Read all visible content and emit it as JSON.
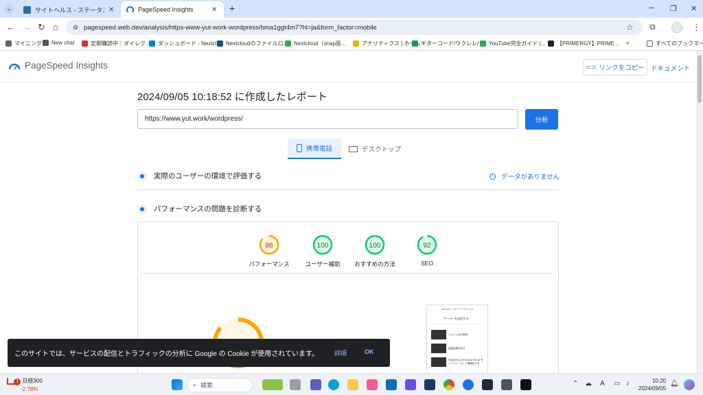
{
  "browser": {
    "tabs": [
      {
        "title": "サイトヘルス - ステータス ‹ サーバーで",
        "active": false
      },
      {
        "title": "PageSpeed Insights",
        "active": true
      }
    ],
    "new_tab": "+",
    "address": "pagespeed.web.dev/analysis/https-www-yut-work-wordpress/bma1ggt4m7?hl=ja&form_factor=mobile",
    "bookmarks": [
      {
        "label": "マイニング",
        "icon": "folder-icon",
        "color": "#5f6368"
      },
      {
        "label": "New chat",
        "icon": "openai-icon",
        "color": "#555555"
      },
      {
        "label": "定期購読中｜ダイレク...",
        "icon": "red-dot-icon",
        "color": "#d93025"
      },
      {
        "label": "ダッシュボード - Nextcl...",
        "icon": "nextcloud-icon",
        "color": "#0082c9"
      },
      {
        "label": "Nextcloudのファイルロ...",
        "icon": "n-icon",
        "color": "#0b5394"
      },
      {
        "label": "Nextcloud（snap版...",
        "icon": "green-icon",
        "color": "#34a853"
      },
      {
        "label": "アナリティクス | ホーム",
        "icon": "analytics-icon",
        "color": "#f9ab00"
      },
      {
        "label": "ギターコード/ウクレレ/ピ...",
        "icon": "chord-icon",
        "color": "#0f9d58"
      },
      {
        "label": "YouTube完全ガイド |...",
        "icon": "green-icon",
        "color": "#34a853"
      },
      {
        "label": "【PRIMERGY】PRIME...",
        "icon": "globe-icon",
        "color": "#202124"
      }
    ],
    "bookmarks_more": "»",
    "all_bookmarks": "すべてのブックマーク"
  },
  "page": {
    "brand": "PageSpeed Insights",
    "copy_link": "リンクをコピー",
    "docs": "ドキュメント",
    "report_title": "2024/09/05 10:18:52 に作成したレポート",
    "url_value": "https://www.yut.work/wordpress/",
    "analyze_button": "分析",
    "device_tabs": [
      {
        "label": "携帯電話",
        "active": true
      },
      {
        "label": "デスクトップ",
        "active": false
      }
    ],
    "field_section": "実際のユーザーの環境で評価する",
    "no_data": "データがありません",
    "lab_section": "パフォーマンスの問題を診断する",
    "scores": [
      {
        "label": "パフォーマンス",
        "value": "86",
        "color": "#ffa400"
      },
      {
        "label": "ユーザー補助",
        "value": "100",
        "color": "#0cce6b"
      },
      {
        "label": "おすすめの方法",
        "value": "100",
        "color": "#0cce6b"
      },
      {
        "label": "SEO",
        "value": "92",
        "color": "#0cce6b"
      }
    ],
    "thumb_lines": [
      "yut.work 〜 サーバーのヘルス",
      "サーバーを自作する！",
      "ドメイン名の取得",
      "容量拡張の仕方",
      "Raspberry pi 5 Ubuntu Server をインストールして最適化する"
    ]
  },
  "cookie": {
    "message": "このサイトでは、サービスの配信とトラフィックの分析に Google の Cookie が使用されています。",
    "details": "詳細",
    "ok": "OK"
  },
  "taskbar": {
    "weather_title": "日経300",
    "weather_value": "-2.78%",
    "search_placeholder": "検索",
    "time": "10:20",
    "date": "2024/09/05",
    "badge": "1"
  }
}
